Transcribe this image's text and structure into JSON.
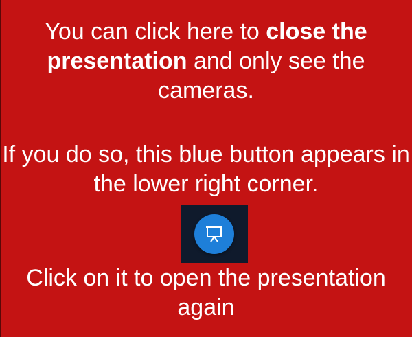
{
  "instruction": {
    "line1_prefix": "You can click here to ",
    "line1_bold": "close the presentation",
    "line1_suffix": " and only see the cameras.",
    "line2": "If you do so, this blue button appears in the lower right corner.",
    "line3": "Click on it to open the presentation again"
  },
  "button": {
    "icon": "presentation-icon",
    "color": "#1e7fd9"
  },
  "colors": {
    "background": "#c41313",
    "text": "#ffffff",
    "button_frame": "#0f1a2c"
  }
}
